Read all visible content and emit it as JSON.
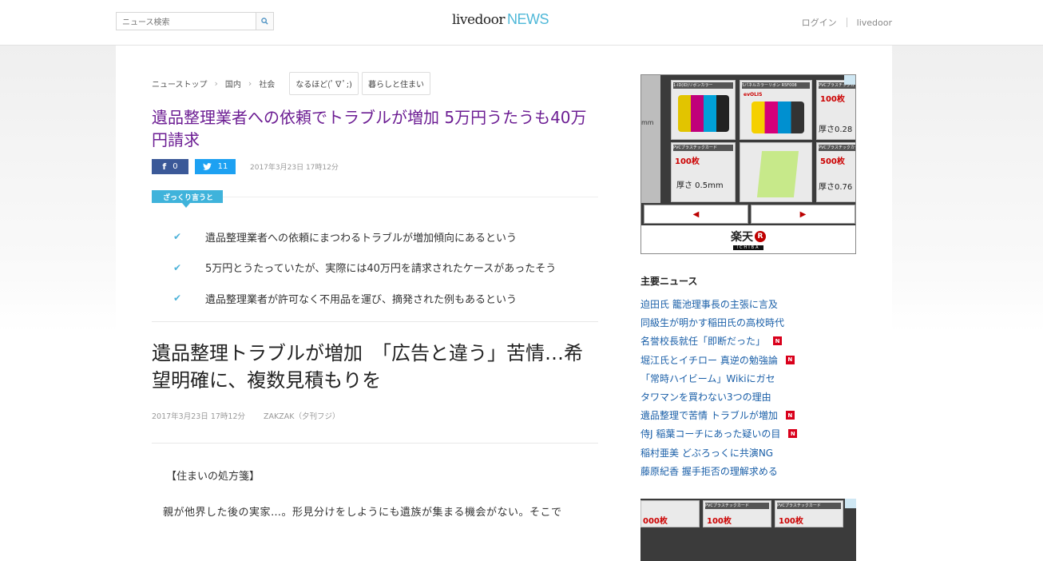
{
  "header": {
    "search_placeholder": "ニュース検索",
    "logo_main": "livedoor",
    "logo_news": "NEWS",
    "login": "ログイン",
    "livedoor_link": "livedoor"
  },
  "breadcrumb": [
    "ニューストップ",
    "国内",
    "社会"
  ],
  "tags": [
    "なるほど(ﾟ∇ﾟ;)",
    "暮らしと住まい"
  ],
  "article": {
    "headline": "遺品整理業者への依頼でトラブルが増加 5万円うたうも40万円請求",
    "fb_count": "0",
    "tw_count": "11",
    "date": "2017年3月23日 17時12分",
    "summary_label": "ざっくり言うと",
    "summary": [
      "遺品整理業者への依頼にまつわるトラブルが増加傾向にあるという",
      "5万円とうたっていたが、実際には40万円を請求されたケースがあったそう",
      "遺品整理業者が許可なく不用品を運び、摘発された例もあるという"
    ],
    "title2": "遺品整理トラブルが増加　「広告と違う」苦情…希望明確に、複数見積もりを",
    "meta_date": "2017年3月23日 17時12分",
    "meta_source": "ZAKZAK（夕刊フジ）",
    "body_heading": "【住まいの処方箋】",
    "body_text": "親が他界した後の実家…。形見分けをしようにも遺族が集まる機会がない。そこで"
  },
  "ad": {
    "card_labels": [
      "1-ID(ID)リボンカラー",
      "5パネルカラーリボン R5F008",
      "PVCプラスチックカード"
    ],
    "price_100": "100枚",
    "price_500": "500枚",
    "thick_05": "厚さ 0.5mm",
    "thick_028": "厚さ0.28",
    "thick_076": "厚さ0.76",
    "evolis": "evOLIS",
    "rakuten": "楽天",
    "rakuten_r": "R",
    "ichiba": "ICHIBA"
  },
  "sidebar": {
    "title": "主要ニュース",
    "news": [
      {
        "text": "迫田氏 籠池理事長の主張に言及",
        "new": false
      },
      {
        "text": "同級生が明かす稲田氏の高校時代",
        "new": false
      },
      {
        "text": "名誉校長就任「即断だった」",
        "new": true
      },
      {
        "text": "堀江氏とイチロー 真逆の勉強論",
        "new": true
      },
      {
        "text": "「常時ハイビーム」Wikiにガセ",
        "new": false
      },
      {
        "text": "タワマンを買わない3つの理由",
        "new": false
      },
      {
        "text": "遺品整理で苦情 トラブルが増加",
        "new": true
      },
      {
        "text": "侍J 稲葉コーチにあった疑いの目",
        "new": true
      },
      {
        "text": "稲村亜美 どぶろっくに共演NG",
        "new": false
      },
      {
        "text": "藤原紀香 握手拒否の理解求める",
        "new": false
      }
    ],
    "new_badge": "N"
  },
  "ad2": {
    "price": "100枚",
    "price_left": "000枚"
  }
}
